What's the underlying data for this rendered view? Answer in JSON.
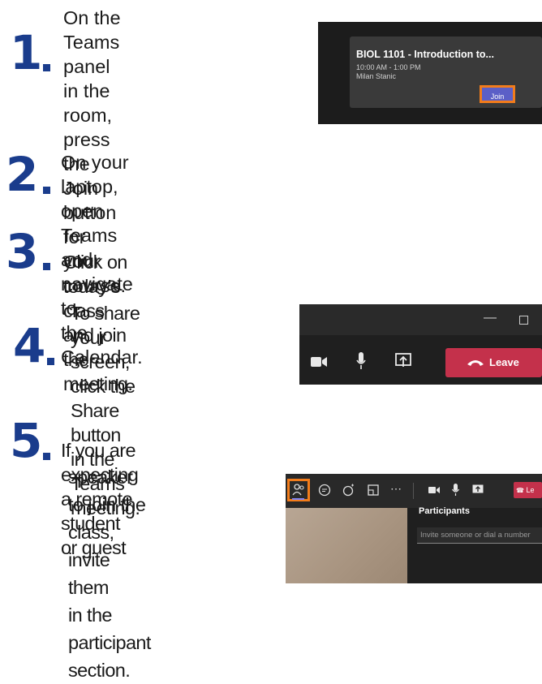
{
  "steps": [
    {
      "number": "1",
      "lines": [
        "On the Teams panel",
        "in the room, press the",
        "Join button for your",
        "course."
      ]
    },
    {
      "number": "2",
      "lines": [
        "On your laptop, open Teams and navigate to",
        "the Calendar."
      ]
    },
    {
      "number": "3",
      "lines": [
        "Click on today’s class and join the meeting."
      ]
    },
    {
      "number": "4",
      "lines": [
        "To share your screen,",
        "click the Share button",
        "in the Teams meeting."
      ]
    },
    {
      "number": "5",
      "lines": [
        "If you are expecting a remote student or guest",
        "speaker to join the",
        "class, invite them",
        "in the participant",
        "section."
      ]
    }
  ],
  "shot1": {
    "title": "BIOL 1101 - Introduction to...",
    "time": "10:00 AM - 1:00 PM",
    "presenter": "Milan Stanic",
    "join": "Join"
  },
  "shot4": {
    "leave": "Leave"
  },
  "shot5": {
    "leave": "Le",
    "participants_heading": "Participants",
    "invite_placeholder": "Invite someone or dial a number"
  },
  "colors": {
    "number_blue": "#1a3c8c",
    "highlight_orange": "#f27c1b",
    "leave_red": "#c4314b",
    "join_purple": "#5b5fc7"
  }
}
